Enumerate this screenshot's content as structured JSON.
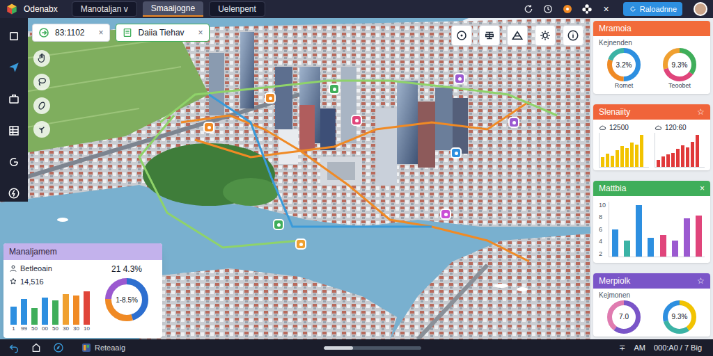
{
  "app": {
    "title": "Odenabx"
  },
  "tabs": [
    {
      "label": "Manotaljan v",
      "selected": false
    },
    {
      "label": "Smaaijogne",
      "selected": true
    },
    {
      "label": "Uelenpent",
      "selected": false
    }
  ],
  "header": {
    "close": "×",
    "button": "Raloadnne"
  },
  "sidebar": {
    "items": [
      {
        "selected": false
      },
      {
        "selected": true
      },
      {
        "selected": false
      },
      {
        "selected": false
      },
      {
        "selected": false
      },
      {
        "selected": false
      }
    ]
  },
  "search_chips": [
    {
      "text": "83:1102",
      "close": "×"
    },
    {
      "text": "Daiia Tiehav",
      "close": "×"
    }
  ],
  "map": {
    "markers": [
      {
        "color": "#e0457b"
      },
      {
        "color": "#9b59d0"
      },
      {
        "color": "#3fae5a"
      },
      {
        "color": "#2d8fe0"
      },
      {
        "color": "#9b59d0"
      },
      {
        "color": "#c94fd6"
      },
      {
        "color": "#3fae5a"
      },
      {
        "color": "#f0a030"
      },
      {
        "color": "#f08a24"
      },
      {
        "color": "#f08a24"
      }
    ]
  },
  "summary_card": {
    "title": "Manaljamem",
    "label": "Betleoain",
    "value": "14,516",
    "chart": {
      "values": [
        30,
        42,
        28,
        45,
        40,
        50,
        48,
        55
      ],
      "colors": [
        "#2d8fe0",
        "#2d8fe0",
        "#3fae5a",
        "#2d8fe0",
        "#3fae5a",
        "#f0a030",
        "#f08a24",
        "#e0453a"
      ],
      "x_labels": [
        "1",
        "99",
        "50",
        "00",
        "50",
        "30",
        "30",
        "10"
      ]
    },
    "stat": "21 4.3%",
    "donut": {
      "text": "1-8.5%",
      "segments": [
        {
          "share": 0.45,
          "color": "#2d6fd0"
        },
        {
          "share": 0.3,
          "color": "#f08a24"
        },
        {
          "share": 0.25,
          "color": "#9b59d0"
        }
      ]
    }
  },
  "right_panel": {
    "cards": [
      {
        "kind": "donuts",
        "title": "Mramoia",
        "header_color": "#f26b3a",
        "subtitle": "Kejnenden",
        "donuts": [
          {
            "text": "3.2%",
            "label": "Romet",
            "segments": [
              {
                "share": 0.5,
                "color": "#2d8fe0"
              },
              {
                "share": 0.3,
                "color": "#f08a24"
              },
              {
                "share": 0.2,
                "color": "#3bb3a5"
              }
            ]
          },
          {
            "text": "9.3%",
            "label": "Teoobet",
            "segments": [
              {
                "share": 0.35,
                "color": "#3fae5a"
              },
              {
                "share": 0.35,
                "color": "#e0457b"
              },
              {
                "share": 0.3,
                "color": "#f0a030"
              }
            ]
          }
        ]
      },
      {
        "kind": "mini_bars",
        "title": "Slenaiity",
        "header_color": "#f0643a",
        "action": "☆",
        "charts": [
          {
            "label": "12500",
            "color": "#f2c300",
            "values": [
              10,
              14,
              12,
              18,
              22,
              20,
              26,
              24,
              34
            ]
          },
          {
            "label": "120:60",
            "color": "#e0393a",
            "values": [
              8,
              12,
              14,
              16,
              20,
              24,
              22,
              28,
              36
            ]
          }
        ]
      },
      {
        "kind": "bars",
        "title": "Mattbia",
        "header_color": "#3fae5a",
        "action": "×",
        "ticks": [
          "10",
          "8",
          "6",
          "4",
          "2"
        ],
        "values": [
          5,
          3,
          9.5,
          3.5,
          4,
          3,
          7,
          7.5
        ],
        "colors": [
          "#2d8fe0",
          "#3bb3a5",
          "#2d8fe0",
          "#2d8fe0",
          "#e0457b",
          "#9b59d0",
          "#9b59d0",
          "#e0457b"
        ]
      },
      {
        "kind": "donuts",
        "title": "Merpiolk",
        "header_color": "#7a55c8",
        "action": "☆",
        "subtitle": "Kejmonen",
        "donuts": [
          {
            "text": "7.0",
            "segments": [
              {
                "share": 0.6,
                "color": "#7a55c8"
              },
              {
                "share": 0.4,
                "color": "#e07bb0"
              }
            ]
          },
          {
            "text": "9.3%",
            "segments": [
              {
                "share": 0.4,
                "color": "#f2c300"
              },
              {
                "share": 0.3,
                "color": "#3bb3a5"
              },
              {
                "share": 0.3,
                "color": "#2d8fe0"
              }
            ]
          }
        ]
      }
    ]
  },
  "taskbar": {
    "app": "Reteaaig",
    "scroll_level": 0.3,
    "items": [
      "∓",
      "AM",
      "000:A0 / 7 Big"
    ]
  }
}
